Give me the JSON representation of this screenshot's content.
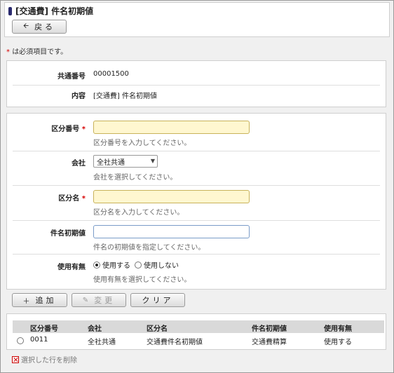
{
  "header": {
    "title": "[交通費] 件名初期値",
    "back_label": "戻る"
  },
  "required_note": {
    "star": "*",
    "text": "は必須項目です。"
  },
  "info": {
    "common_no_label": "共通番号",
    "common_no_value": "00001500",
    "content_label": "内容",
    "content_value": "[交通費] 件名初期値"
  },
  "form": {
    "division_no": {
      "label": "区分番号",
      "required": "*",
      "value": "",
      "hint": "区分番号を入力してください。"
    },
    "company": {
      "label": "会社",
      "value": "全社共通",
      "hint": "会社を選択してください。"
    },
    "division_name": {
      "label": "区分名",
      "required": "*",
      "value": "",
      "hint": "区分名を入力してください。"
    },
    "initial_subject": {
      "label": "件名初期値",
      "value": "",
      "hint": "件名の初期値を指定してください。"
    },
    "usage": {
      "label": "使用有無",
      "option_use": "使用する",
      "option_nouse": "使用しない",
      "selected": "使用する",
      "hint": "使用有無を選択してください。"
    }
  },
  "actions": {
    "add_label": "追加",
    "change_label": "変更",
    "clear_label": "クリア"
  },
  "table": {
    "columns": [
      "区分番号",
      "会社",
      "区分名",
      "件名初期値",
      "使用有無"
    ],
    "rows": [
      {
        "division_no": "0011",
        "company": "全社共通",
        "division_name": "交通費件名初期値",
        "initial_subject": "交通費精算",
        "usage": "使用する"
      }
    ]
  },
  "delete_label": "選択した行を削除"
}
